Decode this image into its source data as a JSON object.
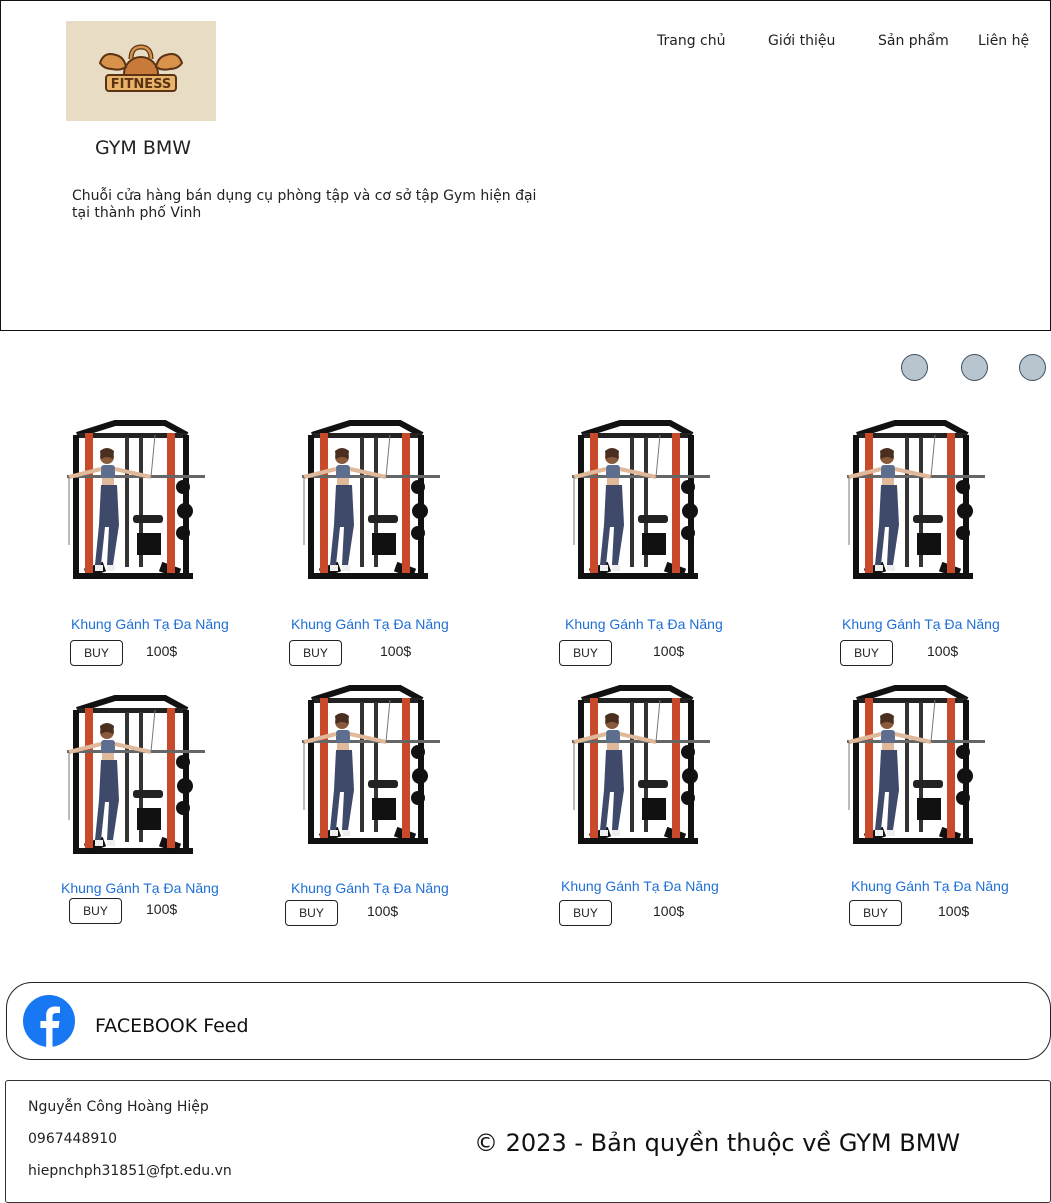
{
  "header": {
    "logo_text": "FITNESS",
    "brand": "GYM BMW",
    "tagline": "Chuỗi cửa hàng bán dụng cụ phòng tập và cơ sở tập Gym hiện đại tại thành phố Vinh"
  },
  "nav": {
    "items": [
      "Trang chủ",
      "Giới thiệu",
      "Sản phẩm",
      "Liên hệ"
    ]
  },
  "products": [
    {
      "name": "Khung Gánh Tạ Đa Năng",
      "price": "100$",
      "buy_label": "BUY"
    },
    {
      "name": "Khung Gánh Tạ Đa Năng",
      "price": "100$",
      "buy_label": "BUY"
    },
    {
      "name": "Khung Gánh Tạ Đa Năng",
      "price": "100$",
      "buy_label": "BUY"
    },
    {
      "name": "Khung Gánh Tạ Đa Năng",
      "price": "100$",
      "buy_label": "BUY"
    },
    {
      "name": "Khung Gánh Tạ Đa Năng",
      "price": "100$",
      "buy_label": "BUY"
    },
    {
      "name": "Khung Gánh Tạ Đa Năng",
      "price": "100$",
      "buy_label": "BUY"
    },
    {
      "name": "Khung Gánh Tạ Đa Năng",
      "price": "100$",
      "buy_label": "BUY"
    },
    {
      "name": "Khung Gánh Tạ Đa Năng",
      "price": "100$",
      "buy_label": "BUY"
    }
  ],
  "facebook": {
    "label": "FACEBOOK Feed",
    "icon": "facebook-icon"
  },
  "footer": {
    "name": "Nguyễn Công Hoàng Hiệp",
    "phone": "0967448910",
    "email": "hiepnchph31851@fpt.edu.vn",
    "copyright": "© 2023 - Bản quyền thuộc về GYM BMW"
  },
  "colors": {
    "link": "#1f6fd6",
    "logo_bg": "#e8ddc4",
    "dot_fill": "#b8c4ce",
    "facebook_blue": "#1877f2",
    "rack_red": "#c84a2a"
  }
}
